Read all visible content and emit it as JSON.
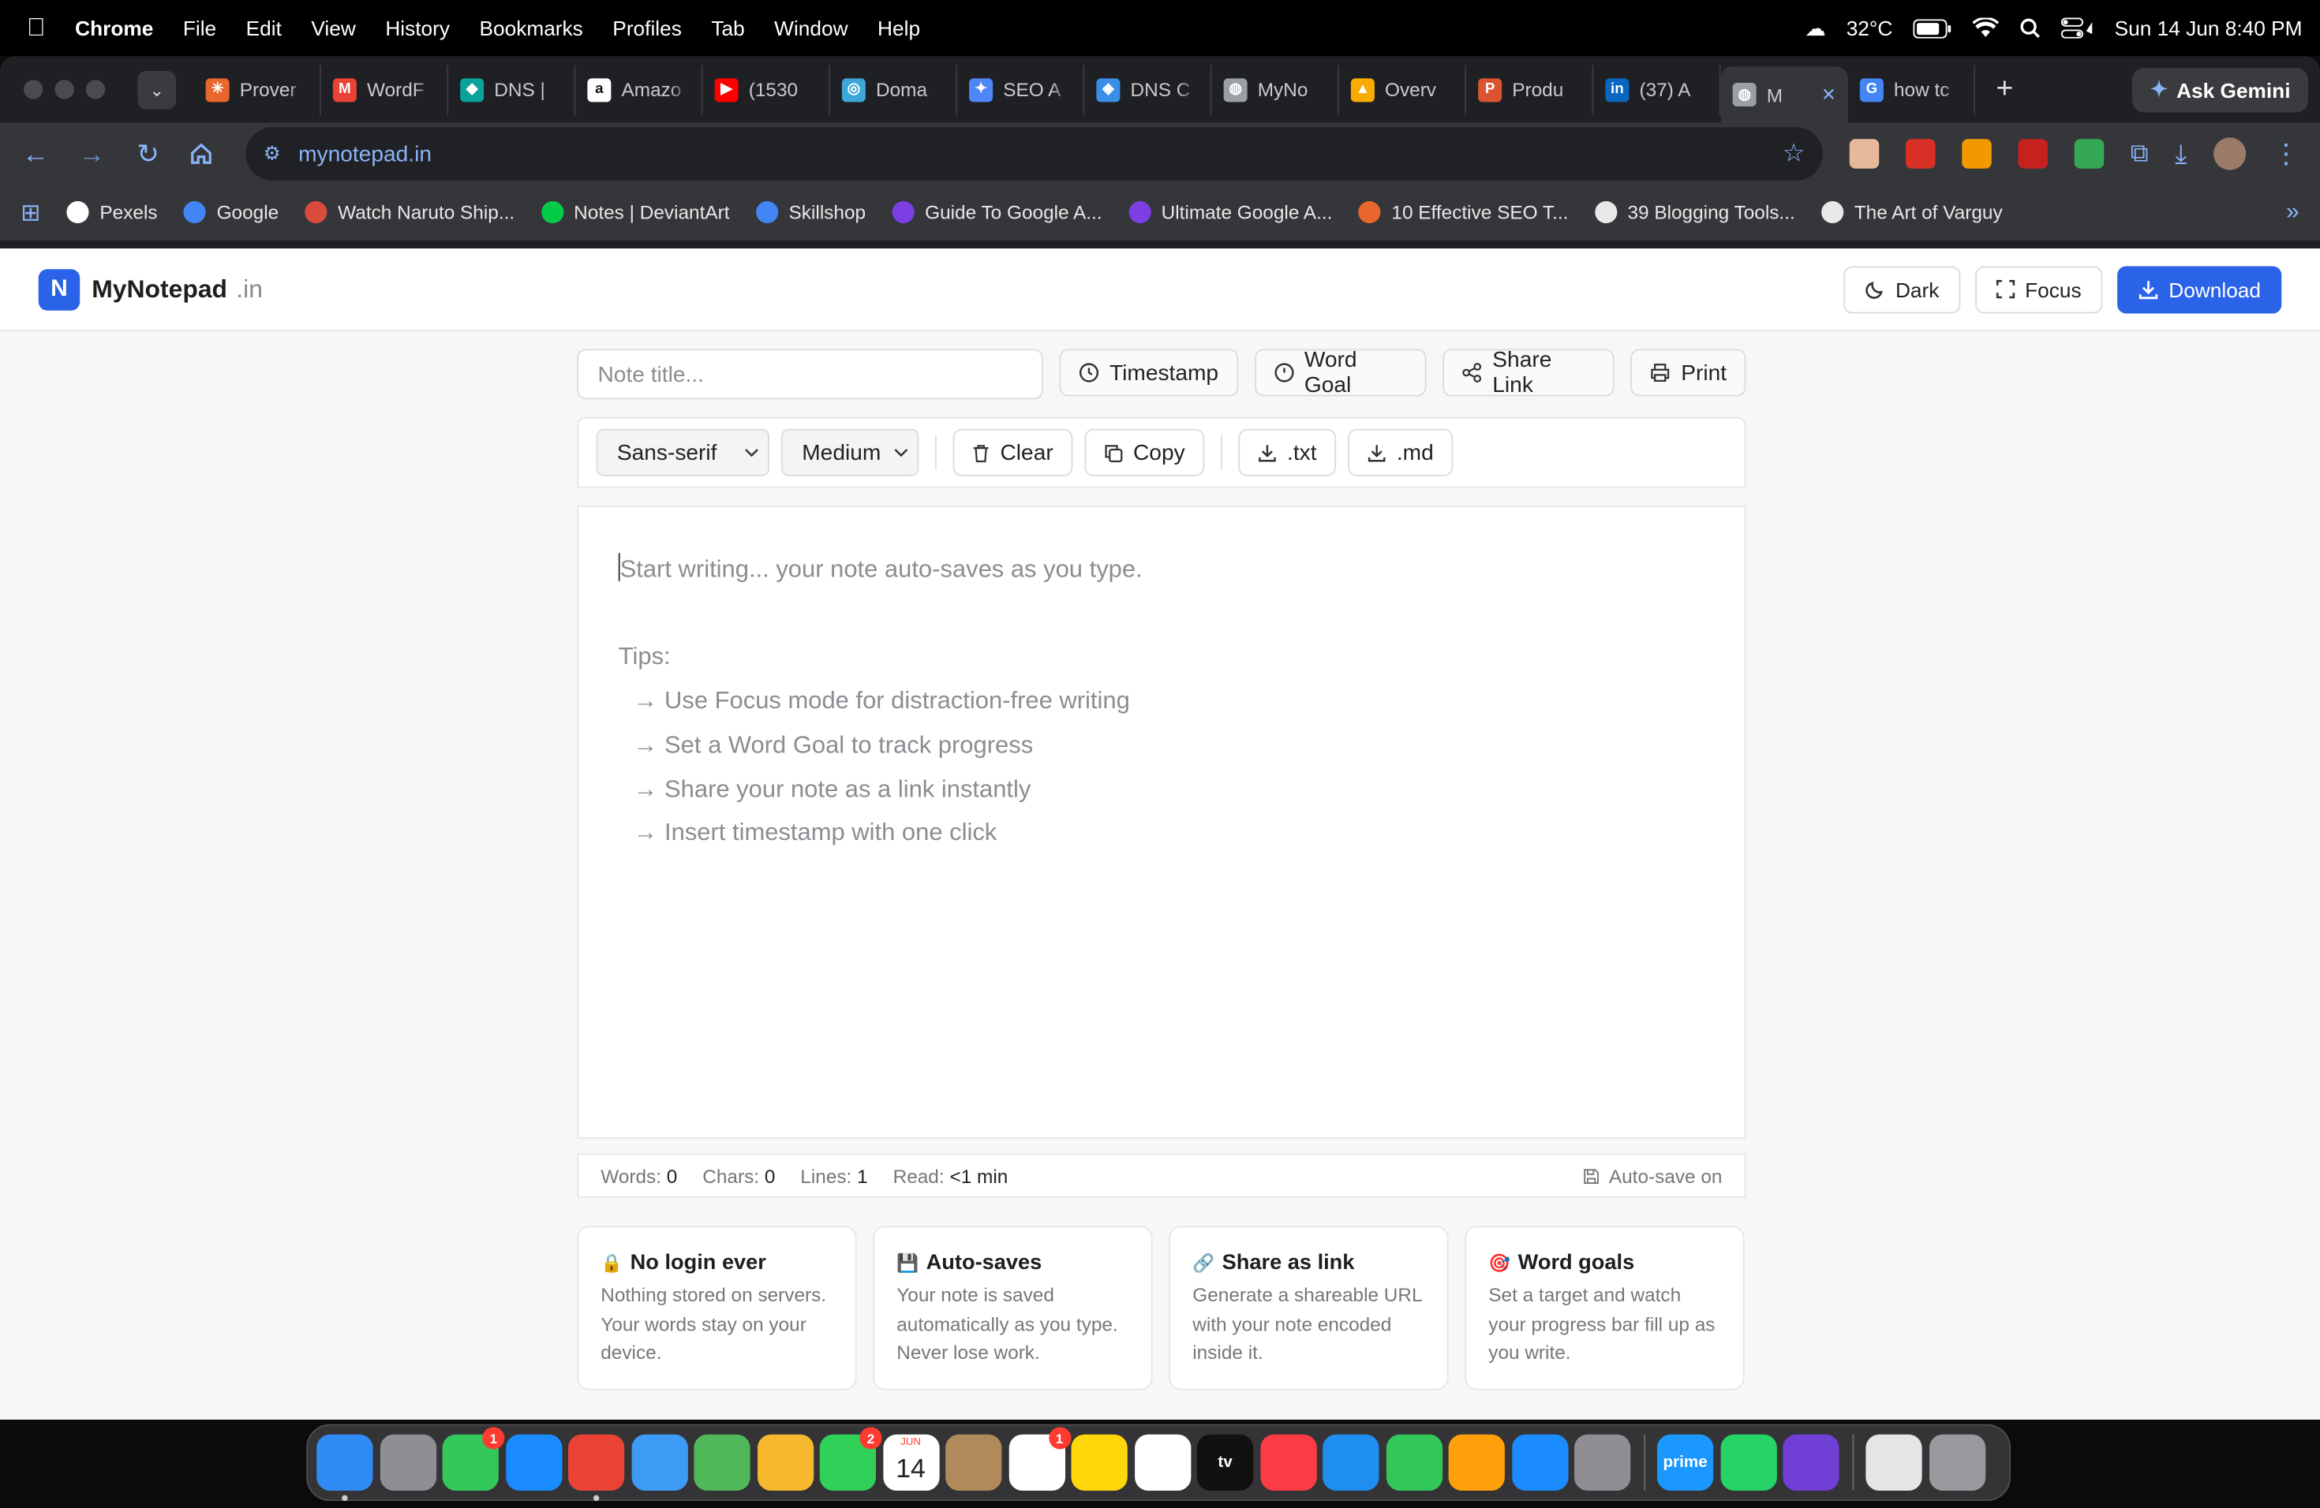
{
  "menubar": {
    "app": "Chrome",
    "items": [
      "File",
      "Edit",
      "View",
      "History",
      "Bookmarks",
      "Profiles",
      "Tab",
      "Window",
      "Help"
    ],
    "weather": "32°C",
    "datetime": "Sun 14 Jun  8:40 PM"
  },
  "tabs": [
    {
      "title": "Prover",
      "color": "#e8672d",
      "glyph": "✳"
    },
    {
      "title": "WordF",
      "color": "#ea4335",
      "glyph": "M"
    },
    {
      "title": "DNS |",
      "color": "#0aa39b",
      "glyph": "◆"
    },
    {
      "title": "Amazo",
      "color": "#ffffff",
      "glyph": "a"
    },
    {
      "title": "(1530",
      "color": "#ff0000",
      "glyph": "▶"
    },
    {
      "title": "Doma",
      "color": "#3ea6d8",
      "glyph": "◎"
    },
    {
      "title": "SEO A",
      "color": "#4e86f7",
      "glyph": "✦"
    },
    {
      "title": "DNS C",
      "color": "#3a8ee6",
      "glyph": "◈"
    },
    {
      "title": "MyNo",
      "color": "#9aa0a6",
      "glyph": "◍"
    },
    {
      "title": "Overv",
      "color": "#f9ab00",
      "glyph": "▲"
    },
    {
      "title": "Produ",
      "color": "#da552f",
      "glyph": "P"
    },
    {
      "title": "(37) A",
      "color": "#0a66c2",
      "glyph": "in"
    },
    {
      "title": "M",
      "color": "#9aa0a6",
      "glyph": "◍",
      "active": true
    },
    {
      "title": "how tc",
      "color": "#4285f4",
      "glyph": "G"
    }
  ],
  "gemini_label": "Ask Gemini",
  "address": "mynotepad.in",
  "bookmarks": [
    {
      "label": "Pexels",
      "color": "#ffffff"
    },
    {
      "label": "Google",
      "color": "#4285f4"
    },
    {
      "label": "Watch Naruto Ship...",
      "color": "#d94c3d"
    },
    {
      "label": "Notes | DeviantArt",
      "color": "#05cc47"
    },
    {
      "label": "Skillshop",
      "color": "#4285f4"
    },
    {
      "label": "Guide To Google A...",
      "color": "#7b3fe4"
    },
    {
      "label": "Ultimate Google A...",
      "color": "#7b3fe4"
    },
    {
      "label": "10 Effective SEO T...",
      "color": "#e8672d"
    },
    {
      "label": "39 Blogging Tools...",
      "color": "#e8e8e8"
    },
    {
      "label": "The Art of Varguy",
      "color": "#e8e8e8"
    }
  ],
  "app": {
    "logo_letter": "N",
    "brand": "MyNotepad",
    "brand_tld": ".in",
    "dark_label": "Dark",
    "focus_label": "Focus",
    "download_label": "Download",
    "title_placeholder": "Note title...",
    "timestamp_label": "Timestamp",
    "wordgoal_label": "Word Goal",
    "sharelink_label": "Share Link",
    "print_label": "Print",
    "font_select": "Sans-serif",
    "size_select": "Medium",
    "clear_label": "Clear",
    "copy_label": "Copy",
    "txt_label": ".txt",
    "md_label": ".md",
    "editor_placeholder": "Start writing... your note auto-saves as you type.",
    "tips_heading": "Tips:",
    "tips": [
      "→ Use Focus mode for distraction-free writing",
      "→ Set a Word Goal to track progress",
      "→ Share your note as a link instantly",
      "→ Insert timestamp with one click"
    ],
    "stats": {
      "words_label": "Words:",
      "words": "0",
      "chars_label": "Chars:",
      "chars": "0",
      "lines_label": "Lines:",
      "lines": "1",
      "read_label": "Read:",
      "read": "<1 min",
      "autosave": "Auto-save on"
    },
    "cards": [
      {
        "icon": "🔒",
        "title": "No login ever",
        "desc": "Nothing stored on servers. Your words stay on your device."
      },
      {
        "icon": "💾",
        "title": "Auto-saves",
        "desc": "Your note is saved automatically as you type. Never lose work."
      },
      {
        "icon": "🔗",
        "title": "Share as link",
        "desc": "Generate a shareable URL with your note encoded inside it."
      },
      {
        "icon": "🎯",
        "title": "Word goals",
        "desc": "Set a target and watch your progress bar fill up as you write."
      }
    ]
  },
  "dock": {
    "apps": [
      {
        "name": "Finder",
        "color": "#2f8cf5"
      },
      {
        "name": "Launchpad",
        "color": "#8e8e93"
      },
      {
        "name": "Messages",
        "color": "#34c759",
        "badge": "1"
      },
      {
        "name": "Safari",
        "color": "#1a8cff"
      },
      {
        "name": "Chrome",
        "color": "#ea4335",
        "running": true
      },
      {
        "name": "Mail",
        "color": "#3d9bf5"
      },
      {
        "name": "Maps",
        "color": "#51b85a"
      },
      {
        "name": "Photos",
        "color": "#f5b82e"
      },
      {
        "name": "FaceTime",
        "color": "#30d158",
        "badge": "2"
      },
      {
        "name": "Calendar",
        "color": "#ffffff",
        "text": "14",
        "top": "JUN"
      },
      {
        "name": "Contacts",
        "color": "#b08a5a"
      },
      {
        "name": "Reminders",
        "color": "#ffffff",
        "badge": "1"
      },
      {
        "name": "Notes",
        "color": "#ffd60a"
      },
      {
        "name": "Freeform",
        "color": "#ffffff"
      },
      {
        "name": "TV",
        "color": "#111111",
        "text": "tv"
      },
      {
        "name": "Music",
        "color": "#fc3c44"
      },
      {
        "name": "Keynote",
        "color": "#1f8ef1"
      },
      {
        "name": "Numbers",
        "color": "#33c759"
      },
      {
        "name": "Pages",
        "color": "#ff9f0a"
      },
      {
        "name": "App Store",
        "color": "#1a8cff"
      },
      {
        "name": "System Settings",
        "color": "#8e8e93"
      }
    ],
    "apps2": [
      {
        "name": "Prime Video",
        "color": "#1a98ff",
        "text": "prime"
      },
      {
        "name": "WhatsApp",
        "color": "#25d366"
      },
      {
        "name": "iMovie",
        "color": "#6f3fd6"
      }
    ],
    "trail": [
      {
        "name": "Document",
        "color": "#e5e5e5"
      },
      {
        "name": "Trash",
        "color": "#9a9a9e"
      }
    ]
  }
}
